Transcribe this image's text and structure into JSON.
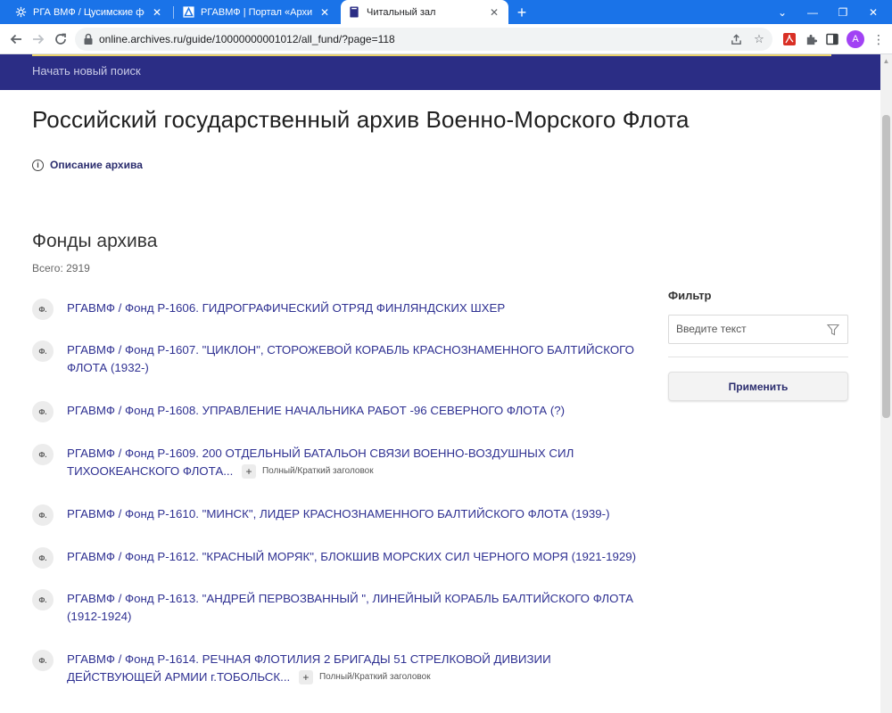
{
  "browser": {
    "tabs": [
      {
        "title": "РГА ВМФ / Цусимские форумы",
        "icon": "gear-icon"
      },
      {
        "title": "РГАВМФ | Портал «Архивы Рос",
        "icon": "archive-logo-icon"
      },
      {
        "title": "Читальный зал",
        "icon": "book-icon"
      }
    ],
    "url": "online.archives.ru/guide/10000000001012/all_fund/?page=118",
    "profile_initial": "A"
  },
  "site": {
    "new_search": "Начать новый поиск",
    "colors": {
      "header_bg": "#2b2d85",
      "accent_stripe": "#e9d16b",
      "link": "#2f3192"
    }
  },
  "archive": {
    "title": "Российский государственный архив Военно-Морского Флота",
    "description_link": "Описание архива"
  },
  "funds": {
    "heading": "Фонды архива",
    "total": "Всего: 2919",
    "badge": "Ф.",
    "toggle_label": "Полный/Краткий заголовок",
    "items": [
      {
        "text": "РГАВМФ / Фонд Р-1606. ГИДРОГРАФИЧЕСКИЙ ОТРЯД ФИНЛЯНДСКИХ ШХЕР",
        "collapsible": false
      },
      {
        "text": "РГАВМФ / Фонд Р-1607. \"ЦИКЛОН\", СТОРОЖЕВОЙ КОРАБЛЬ КРАСНОЗНАМЕННОГО БАЛТИЙСКОГО ФЛОТА (1932-)",
        "collapsible": false
      },
      {
        "text": "РГАВМФ / Фонд Р-1608. УПРАВЛЕНИЕ НАЧАЛЬНИКА РАБОТ -96 СЕВЕРНОГО ФЛОТА (?)",
        "collapsible": false
      },
      {
        "text": "РГАВМФ / Фонд Р-1609. 200 ОТДЕЛЬНЫЙ БАТАЛЬОН СВЯЗИ ВОЕННО-ВОЗДУШНЫХ СИЛ ТИХООКЕАНСКОГО ФЛОТА...",
        "collapsible": true
      },
      {
        "text": "РГАВМФ / Фонд Р-1610. \"МИНСК\", ЛИДЕР КРАСНОЗНАМЕННОГО БАЛТИЙСКОГО ФЛОТА (1939-)",
        "collapsible": false
      },
      {
        "text": "РГАВМФ / Фонд Р-1612. \"КРАСНЫЙ МОРЯК\", БЛОКШИВ МОРСКИХ СИЛ ЧЕРНОГО МОРЯ (1921-1929)",
        "collapsible": false
      },
      {
        "text": "РГАВМФ / Фонд Р-1613. \"АНДРЕЙ ПЕРВОЗВАННЫЙ \", ЛИНЕЙНЫЙ КОРАБЛЬ БАЛТИЙСКОГО ФЛОТА (1912-1924)",
        "collapsible": false
      },
      {
        "text": "РГАВМФ / Фонд Р-1614. РЕЧНАЯ ФЛОТИЛИЯ 2 БРИГАДЫ 51 СТРЕЛКОВОЙ ДИВИЗИИ ДЕЙСТВУЮЩЕЙ АРМИИ г.ТОБОЛЬСК...",
        "collapsible": true
      }
    ]
  },
  "filter": {
    "label": "Фильтр",
    "placeholder": "Введите текст",
    "value": "",
    "apply_label": "Применить"
  }
}
